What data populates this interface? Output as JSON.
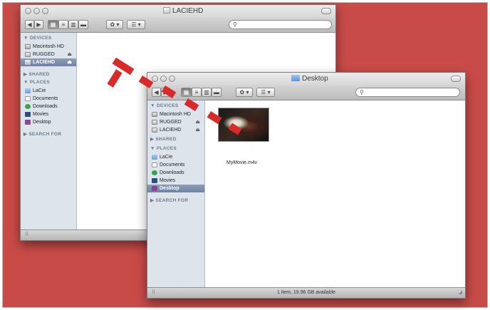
{
  "colors": {
    "background": "#c94b48",
    "dashed_arrow": "#d92a2a",
    "selection": "#7a8cab"
  },
  "back_window": {
    "title": "LACIEHD",
    "search": {
      "value": "",
      "placeholder": ""
    },
    "sidebar": {
      "devices_header": "▼ DEVICES",
      "devices": [
        {
          "label": "Macintosh HD",
          "icon": "hard-drive-icon",
          "eject": ""
        },
        {
          "label": "RUGGED",
          "icon": "external-drive-icon",
          "eject": "⏏"
        },
        {
          "label": "LACIEHD",
          "icon": "external-drive-icon",
          "eject": "⏏",
          "selected": true
        }
      ],
      "shared_header": "▶ SHARED",
      "places_header": "▼ PLACES",
      "places": [
        {
          "label": "LaCie",
          "icon": "folder-icon"
        },
        {
          "label": "Documents",
          "icon": "documents-icon"
        },
        {
          "label": "Downloads",
          "icon": "downloads-icon"
        },
        {
          "label": "Movies",
          "icon": "movies-icon"
        },
        {
          "label": "Desktop",
          "icon": "desktop-icon"
        }
      ],
      "search_header": "▶ SEARCH FOR"
    },
    "toolbar": {
      "back": "◀",
      "forward": "▶",
      "action": "✿ ▾",
      "arrange": "☰ ▾"
    },
    "status_text": ""
  },
  "front_window": {
    "title": "Desktop",
    "search": {
      "value": "",
      "placeholder": ""
    },
    "sidebar": {
      "devices_header": "▼ DEVICES",
      "devices": [
        {
          "label": "Macintosh HD",
          "icon": "hard-drive-icon",
          "eject": ""
        },
        {
          "label": "RUGGED",
          "icon": "external-drive-icon",
          "eject": "⏏"
        },
        {
          "label": "LACIEHD",
          "icon": "external-drive-icon",
          "eject": "⏏"
        }
      ],
      "shared_header": "▶ SHARED",
      "places_header": "▼ PLACES",
      "places": [
        {
          "label": "LaCie",
          "icon": "folder-icon"
        },
        {
          "label": "Documents",
          "icon": "documents-icon"
        },
        {
          "label": "Downloads",
          "icon": "downloads-icon"
        },
        {
          "label": "Movies",
          "icon": "movies-icon"
        },
        {
          "label": "Desktop",
          "icon": "desktop-icon",
          "selected": true
        }
      ],
      "search_header": "▶ SEARCH FOR"
    },
    "toolbar": {
      "back": "◀",
      "forward": "▶",
      "action": "✿ ▾",
      "arrange": "☰ ▾"
    },
    "file": {
      "name": "MyMovie.m4v",
      "icon": "movie-thumbnail"
    },
    "status_text": "1 item, 19.96 GB available"
  }
}
